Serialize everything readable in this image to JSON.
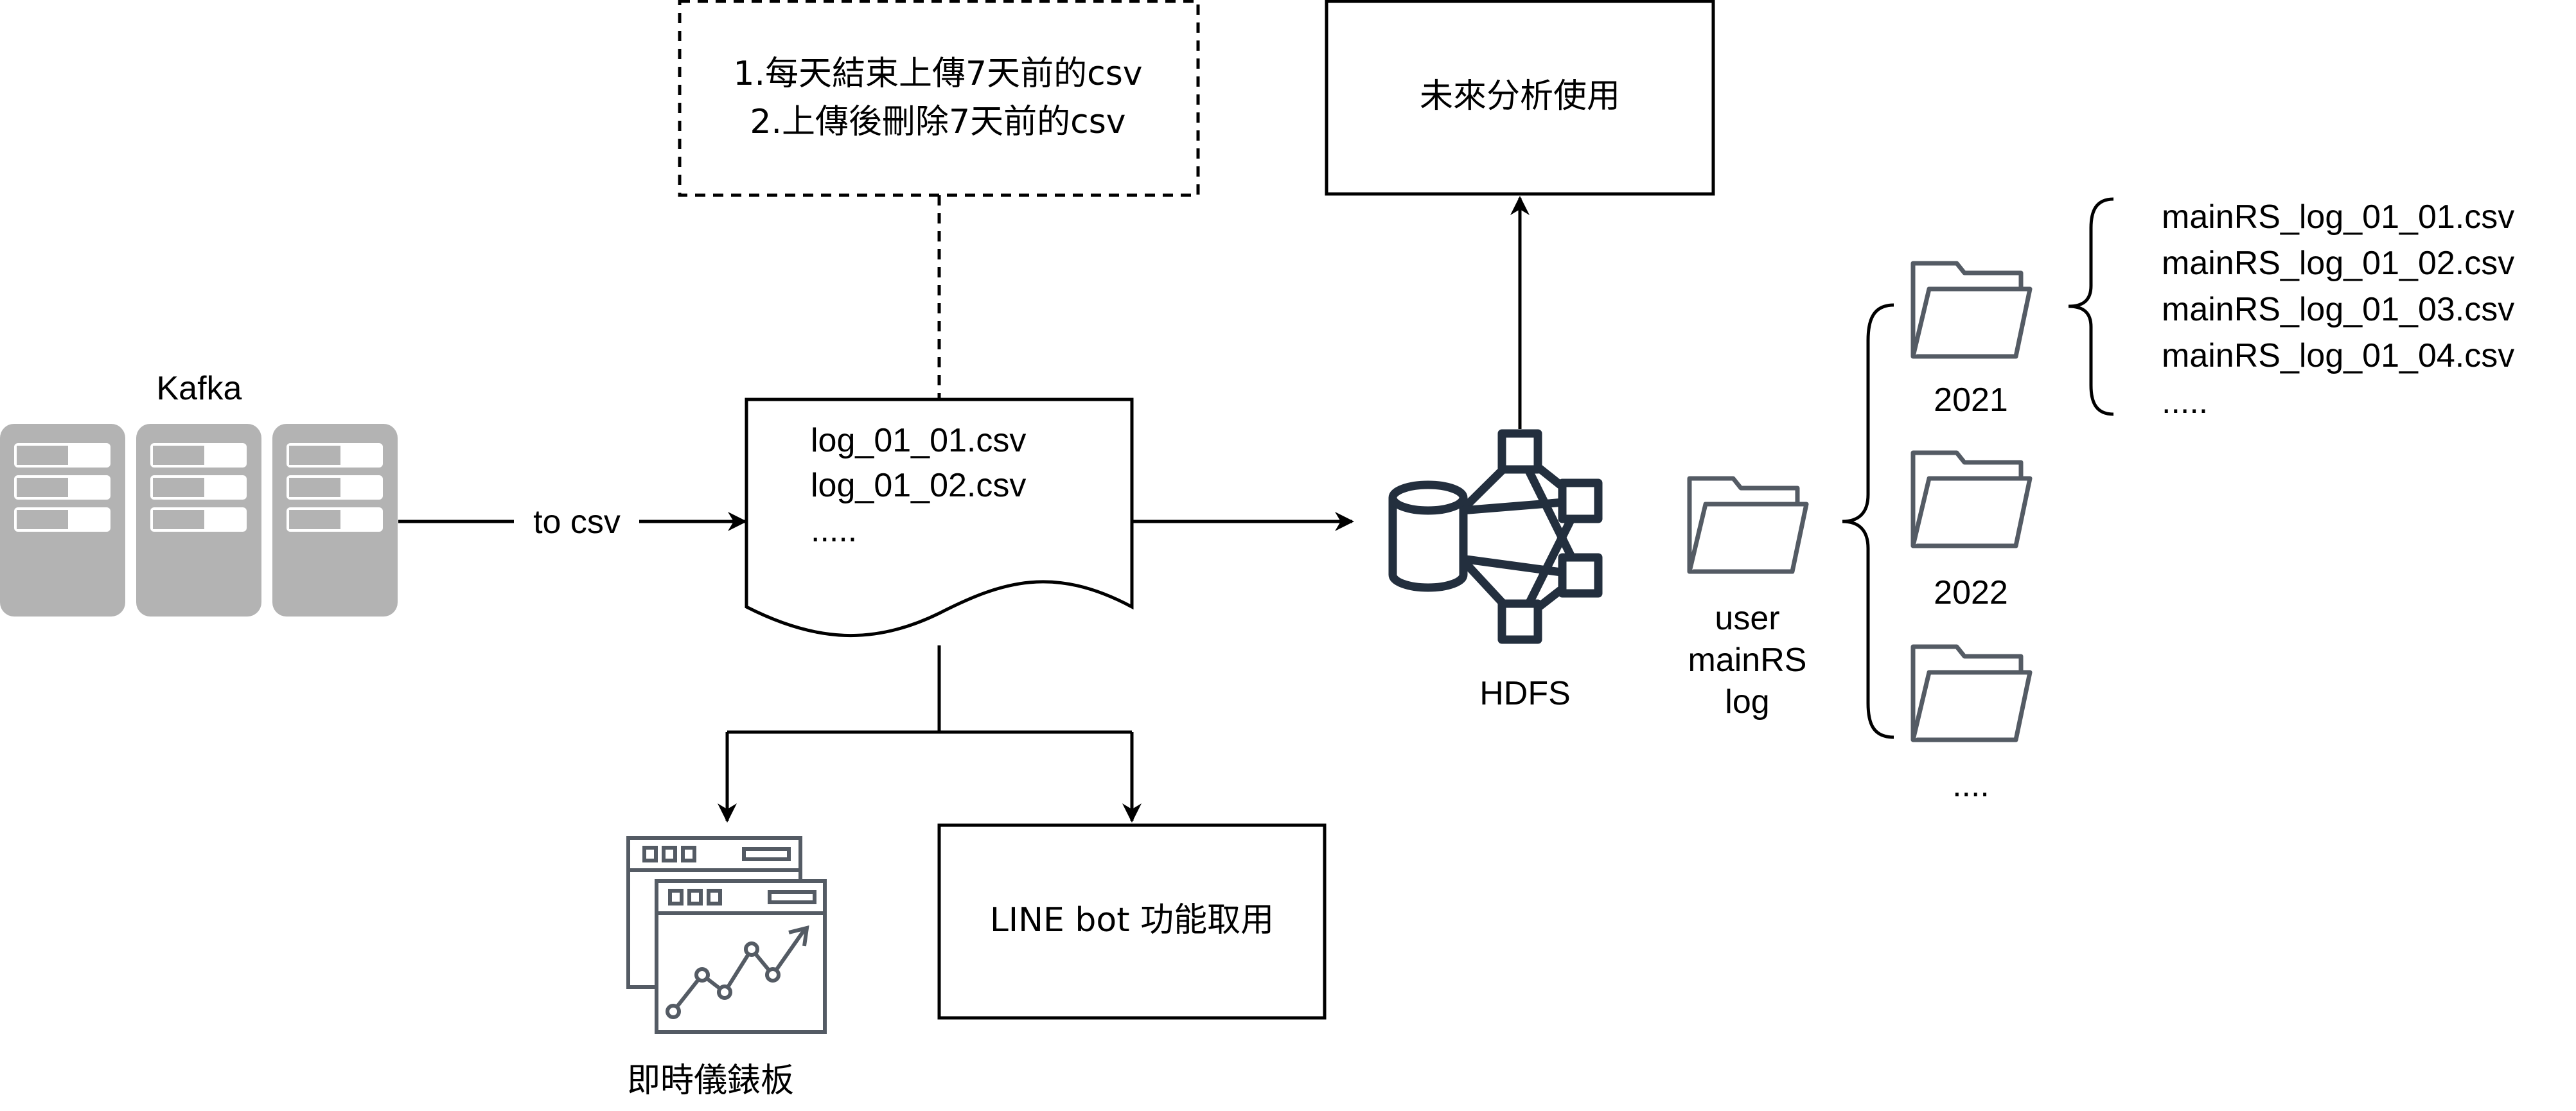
{
  "kafka": {
    "label": "Kafka"
  },
  "edge_to_csv": {
    "label": "to csv"
  },
  "note": {
    "line1": "1.每天結束上傳7天前的csv",
    "line2": "2.上傳後刪除7天前的csv"
  },
  "csv_doc": {
    "line1": "log_01_01.csv",
    "line2": "log_01_02.csv",
    "line3": "....."
  },
  "future_box": {
    "label": "未來分析使用"
  },
  "hdfs": {
    "label": "HDFS"
  },
  "root_folder": {
    "line1": "user",
    "line2": "mainRS",
    "line3": "log"
  },
  "year_folders": [
    "2021",
    "2022",
    "...."
  ],
  "files_2021": [
    "mainRS_log_01_01.csv",
    "mainRS_log_01_02.csv",
    "mainRS_log_01_03.csv",
    "mainRS_log_01_04.csv",
    "....."
  ],
  "dashboard": {
    "label": "即時儀錶板"
  },
  "line_bot_box": {
    "label": "LINE bot 功能取用"
  },
  "colors": {
    "line": "#000000",
    "server": "#b3b3b3",
    "hdfs_icon": "#232f3e",
    "dashboard_icon": "#545b64",
    "folder": "#545b64"
  }
}
